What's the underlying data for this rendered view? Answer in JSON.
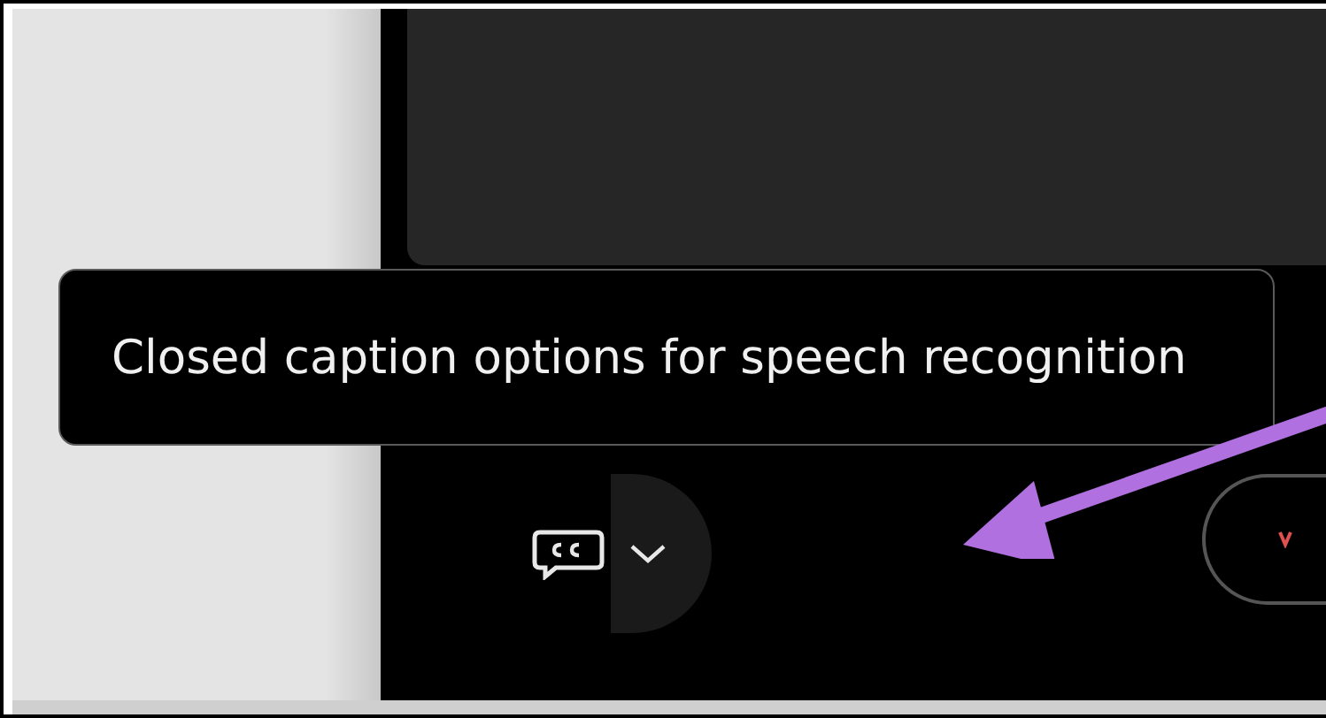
{
  "tooltip": {
    "text": "Closed caption options for speech recognition"
  }
}
